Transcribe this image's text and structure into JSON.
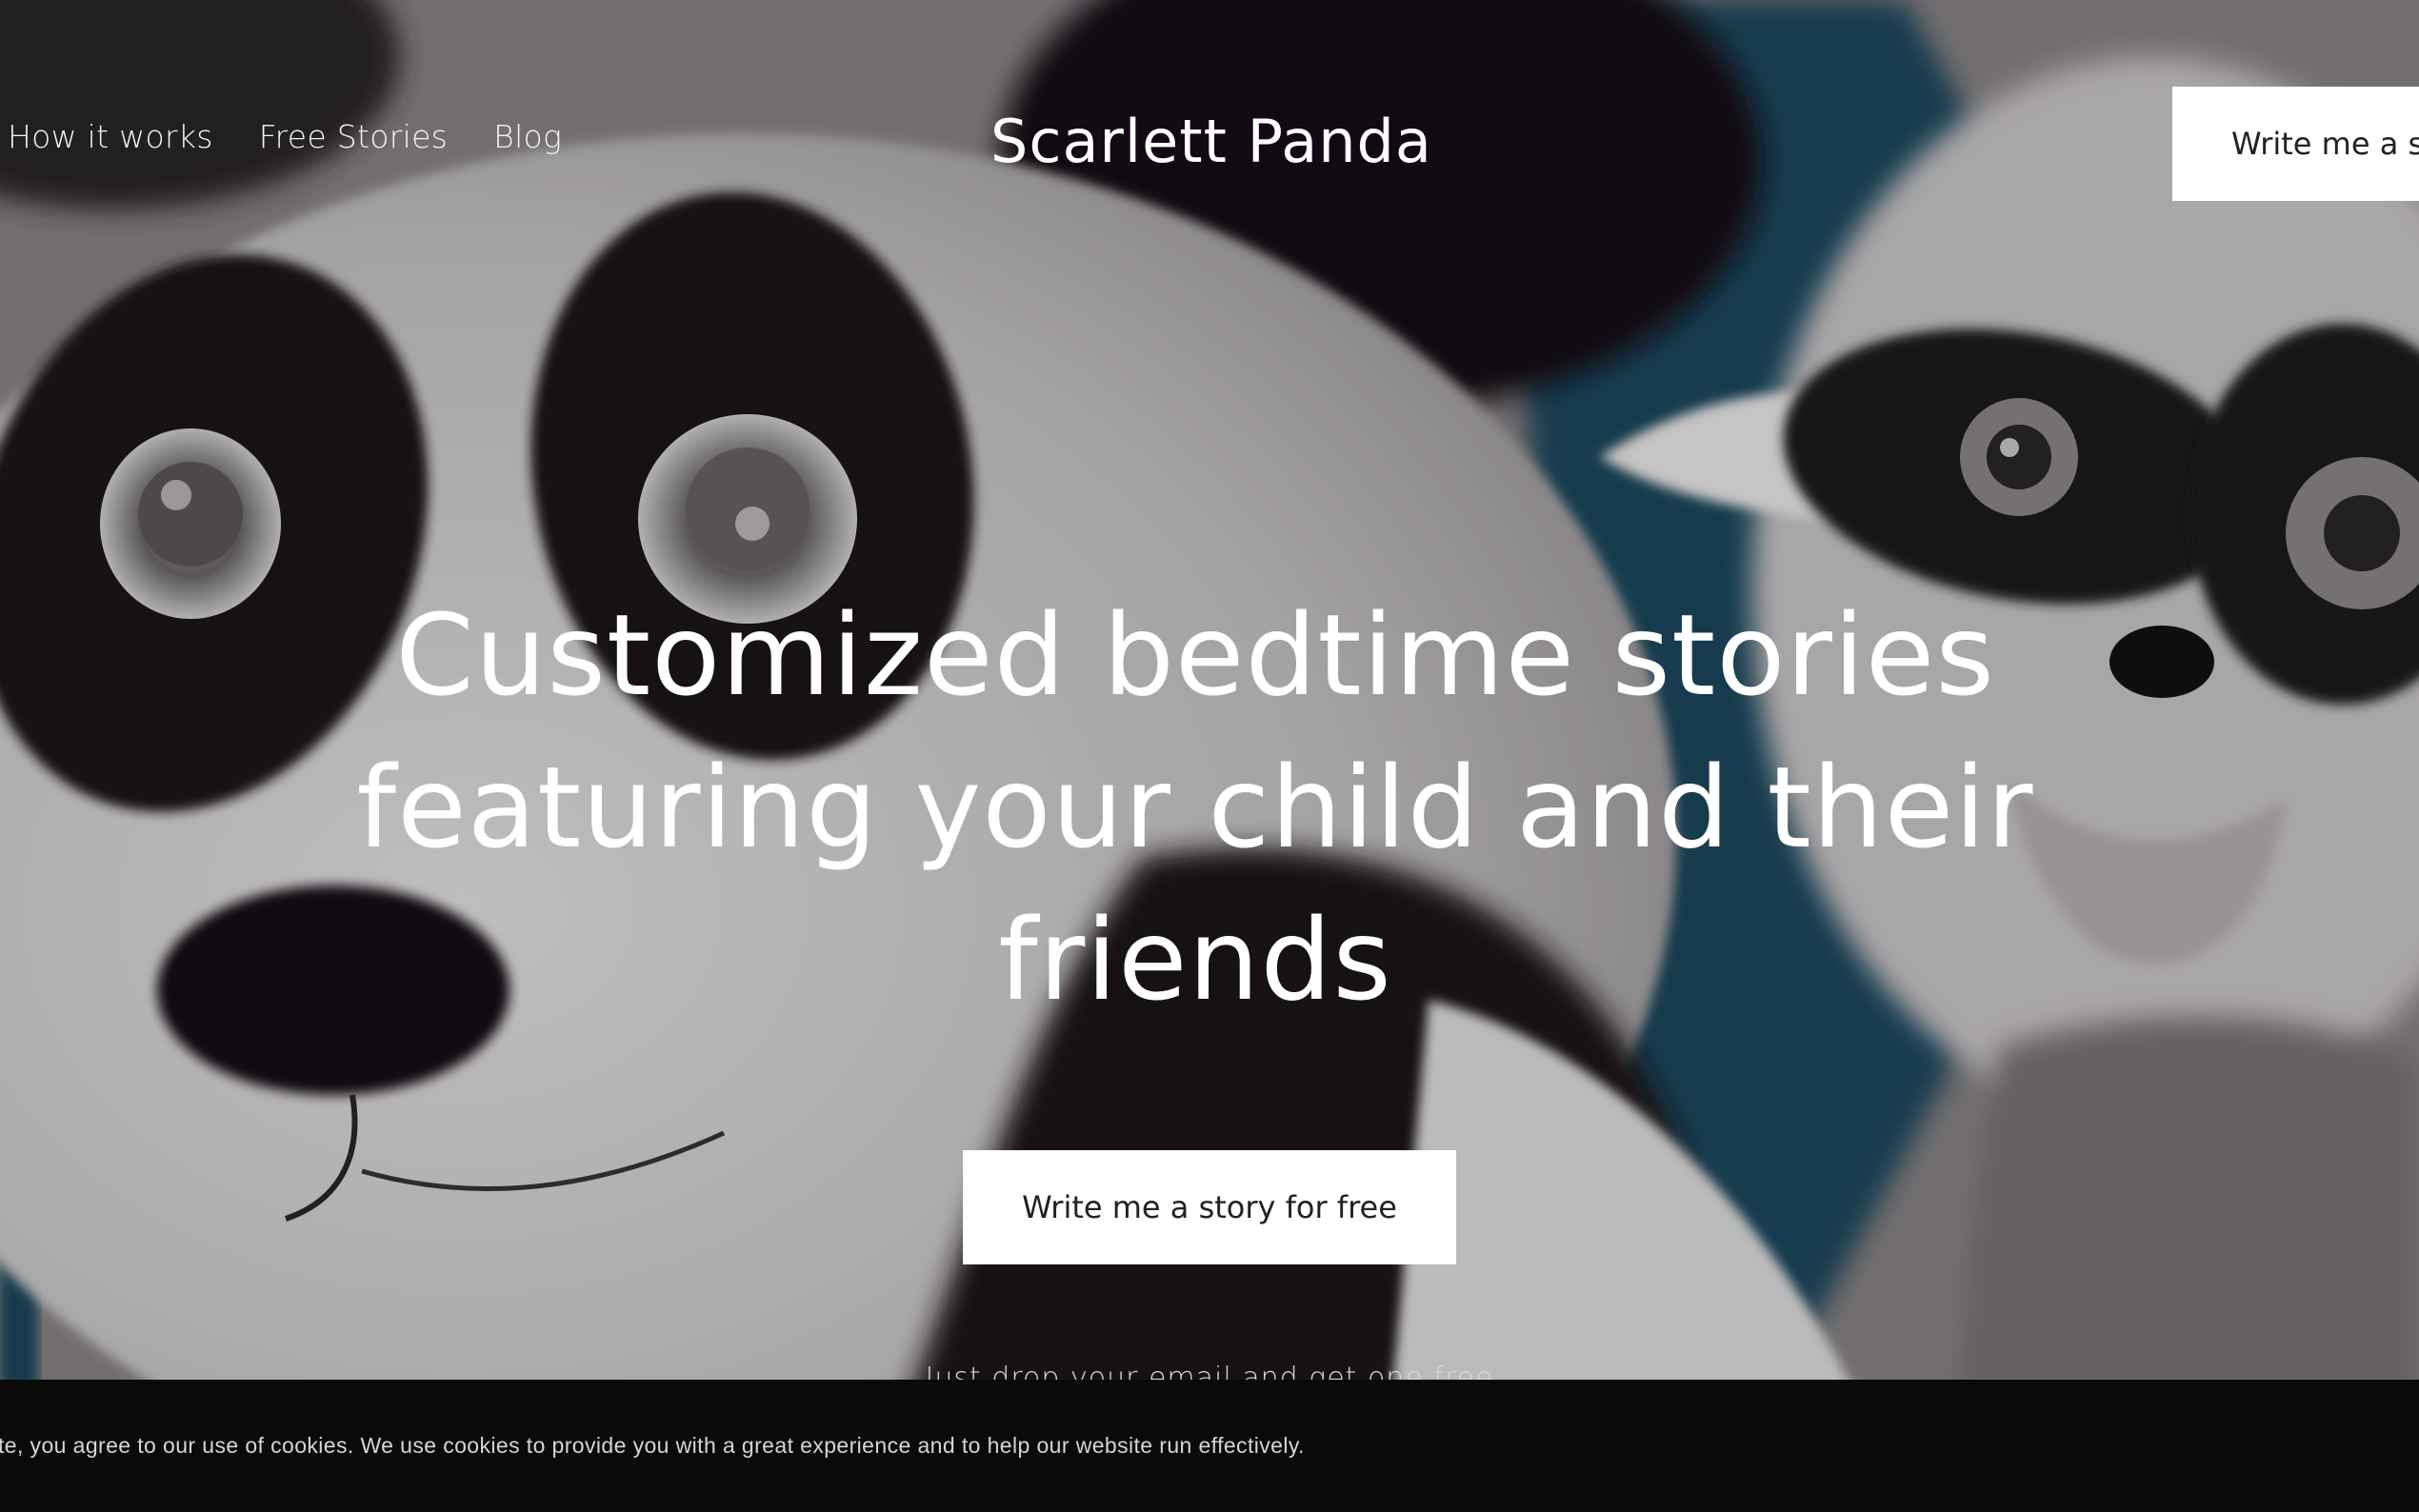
{
  "nav": {
    "links": [
      {
        "label": "How it works"
      },
      {
        "label": "Free Stories"
      },
      {
        "label": "Blog"
      }
    ]
  },
  "header": {
    "site_title": "Scarlett Panda",
    "cta_label": "Write me a s"
  },
  "hero": {
    "heading_lines": [
      "Customized bedtime stories",
      "featuring your child and their",
      "friends"
    ],
    "cta_label": "Write me a story for free",
    "note": "Just drop your email and get one free"
  },
  "cookie_banner": {
    "text": "te, you agree to our use of cookies. We use cookies to provide you with a great experience and to help our website run effectively."
  },
  "colors": {
    "button_bg": "#ffffff",
    "button_text": "#222222",
    "banner_bg": "#0a0a0a",
    "accent_teal": "#1f4a5e"
  },
  "icons": {
    "hero_illustration": "panda-and-raccoon-illustration"
  }
}
